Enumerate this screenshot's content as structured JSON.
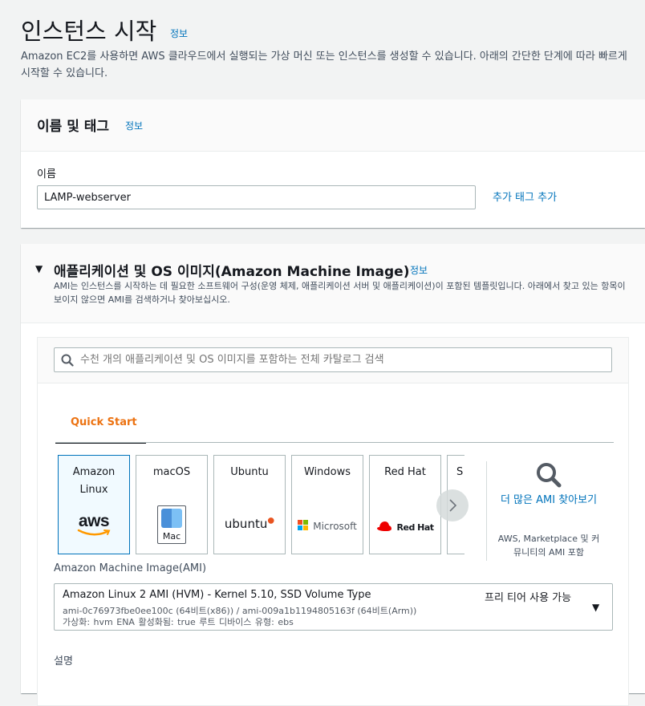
{
  "page": {
    "title": "인스턴스 시작",
    "info": "정보",
    "description": "Amazon EC2를 사용하면 AWS 클라우드에서 실행되는 가상 머신 또는 인스턴스를 생성할 수 있습니다. 아래의 간단한 단계에 따라 빠르게 시작할 수 있습니다."
  },
  "name_tags": {
    "title": "이름 및 태그",
    "info": "정보",
    "name_label": "이름",
    "name_value": "LAMP-webserver",
    "add_tag": "추가 태그 추가"
  },
  "ami_section": {
    "title": "애플리케이션 및 OS 이미지(Amazon Machine Image)",
    "info": "정보",
    "description": "AMI는 인스턴스를 시작하는 데 필요한 소프트웨어 구성(운영 체제, 애플리케이션 서버 및 애플리케이션)이 포함된 템플릿입니다. 아래에서 찾고 있는 항목이 보이지 않으면 AMI를 검색하거나 찾아보십시오.",
    "search_placeholder": "수천 개의 애플리케이션 및 OS 이미지를 포함하는 전체 카탈로그 검색",
    "tab_quick_start": "Quick Start",
    "os_cards": [
      {
        "name_line1": "Amazon",
        "name_line2": "Linux",
        "logo": "aws"
      },
      {
        "name_line1": "macOS",
        "name_line2": "",
        "logo": "Mac"
      },
      {
        "name_line1": "Ubuntu",
        "name_line2": "",
        "logo": "ubuntu"
      },
      {
        "name_line1": "Windows",
        "name_line2": "",
        "logo": "Microsoft"
      },
      {
        "name_line1": "Red Hat",
        "name_line2": "",
        "logo": "Red Hat"
      },
      {
        "name_line1": "S",
        "name_line2": "",
        "logo": ""
      }
    ],
    "more_ami_label": "더 많은 AMI 찾아보기",
    "more_ami_sub": "AWS, Marketplace 및 커뮤니티의 AMI 포함",
    "ami_label": "Amazon Machine Image(AMI)",
    "ami_selected": {
      "name": "Amazon Linux 2 AMI (HVM) - Kernel 5.10, SSD Volume Type",
      "ids": "ami-0c76973fbe0ee100c (64비트(x86)) / ami-009a1b1194805163f (64비트(Arm))",
      "attrs": "가상화: hvm    ENA 활성화됨: true    루트 디바이스 유형: ebs",
      "free_tier": "프리 티어 사용 가능"
    },
    "description_label": "설명"
  },
  "colors": {
    "link": "#0073bb",
    "accent": "#ec7211",
    "selected_border": "#0073bb"
  }
}
